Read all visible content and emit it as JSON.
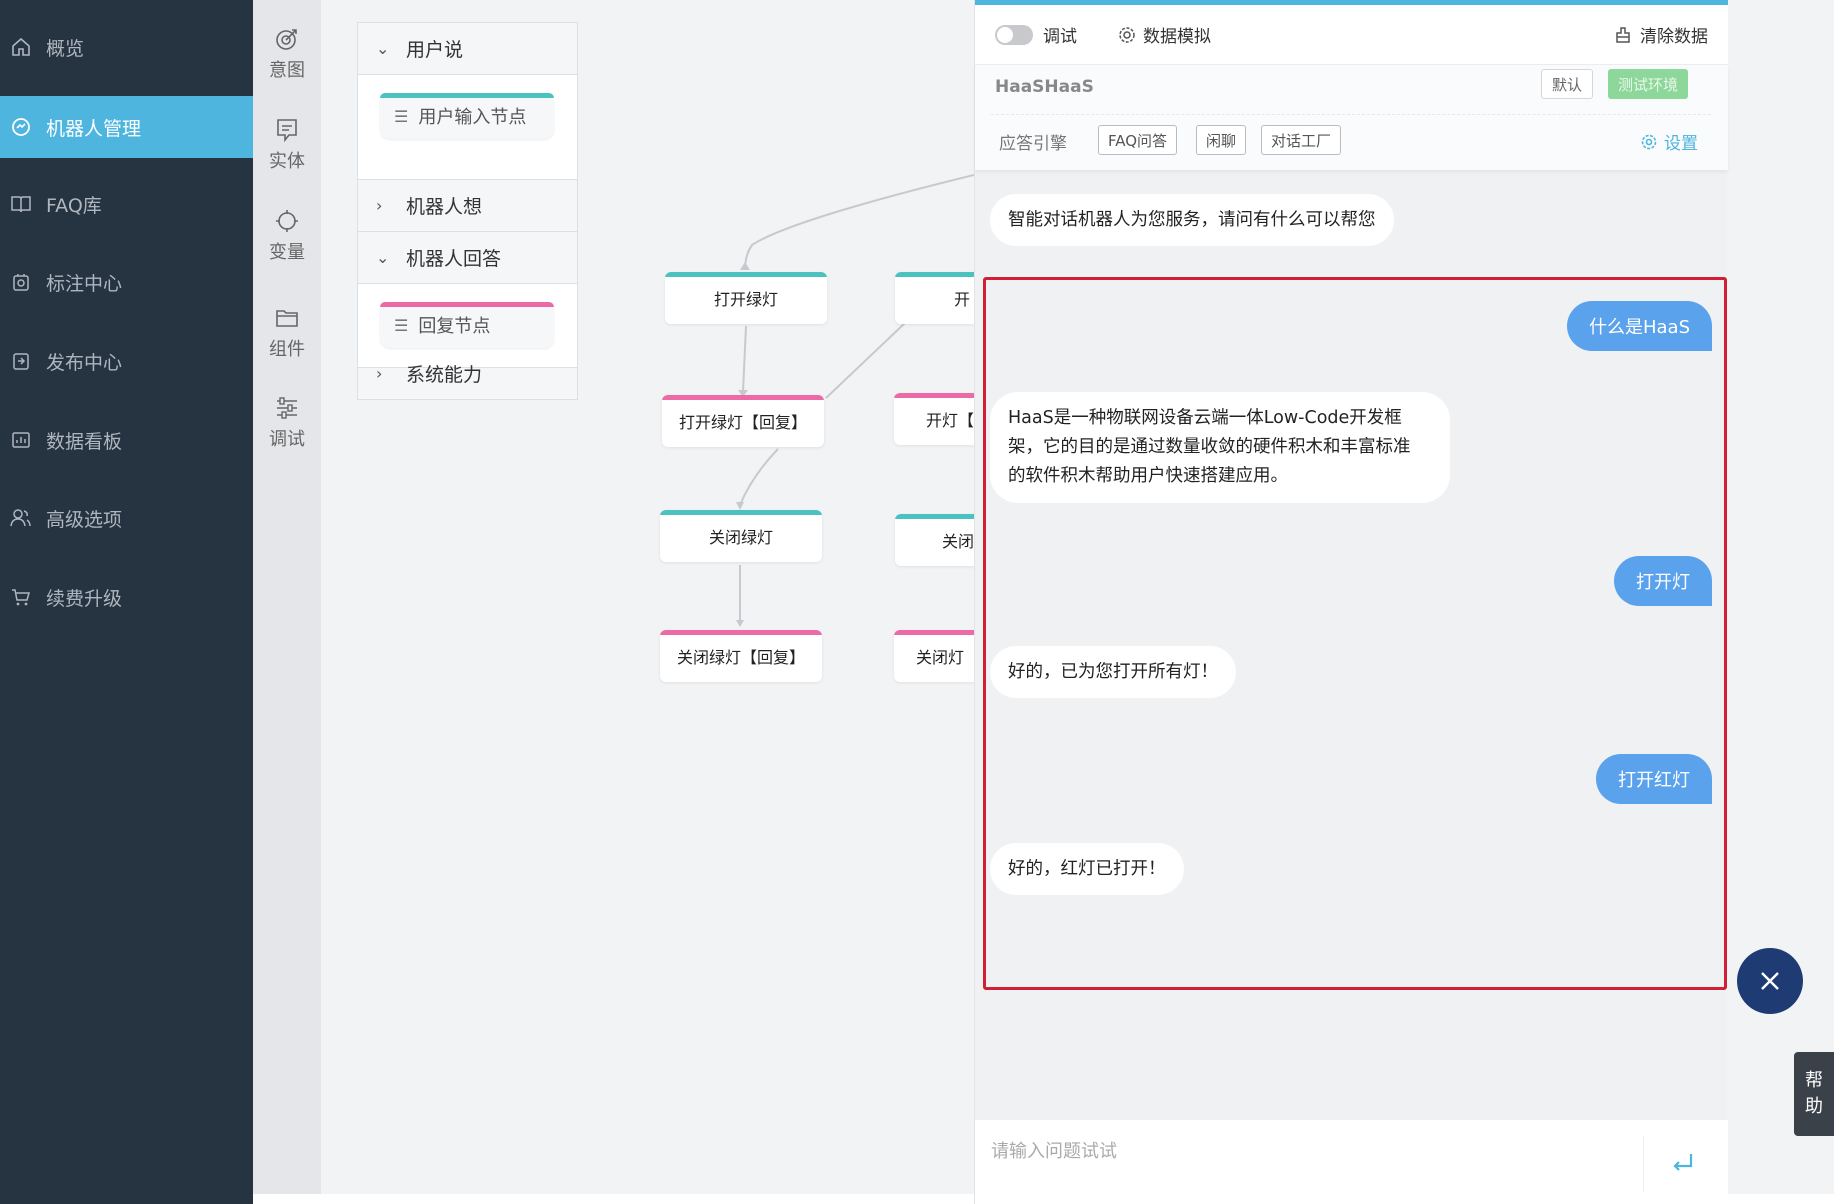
{
  "sidebar": {
    "items": [
      {
        "label": "概览",
        "icon": "home-icon",
        "active": false
      },
      {
        "label": "机器人管理",
        "icon": "robot-icon",
        "active": true
      },
      {
        "label": "FAQ库",
        "icon": "book-icon",
        "active": false
      },
      {
        "label": "标注中心",
        "icon": "tag-icon",
        "active": false
      },
      {
        "label": "发布中心",
        "icon": "publish-icon",
        "active": false
      },
      {
        "label": "数据看板",
        "icon": "dashboard-icon",
        "active": false
      },
      {
        "label": "高级选项",
        "icon": "users-icon",
        "active": false
      },
      {
        "label": "续费升级",
        "icon": "cart-icon",
        "active": false
      }
    ]
  },
  "tools": [
    {
      "label": "意图",
      "icon": "intent-icon"
    },
    {
      "label": "实体",
      "icon": "entity-icon"
    },
    {
      "label": "变量",
      "icon": "variable-icon"
    },
    {
      "label": "组件",
      "icon": "folder-icon"
    },
    {
      "label": "调试",
      "icon": "sliders-icon"
    }
  ],
  "palette": {
    "user_says": "用户说",
    "user_input_node": "用户输入节点",
    "robot_thinks": "机器人想",
    "robot_answers": "机器人回答",
    "reply_node": "回复节点",
    "system_ability": "系统能力"
  },
  "flow": {
    "nodes": [
      "打开绿灯",
      "打开绿灯【回复】",
      "关闭绿灯",
      "关闭绿灯【回复】",
      "开",
      "开灯【",
      "关闭",
      "关闭灯"
    ]
  },
  "chat": {
    "debug_label": "调试",
    "simulate_label": "数据模拟",
    "clear_label": "清除数据",
    "bot_name": "HaaSHaaS",
    "tag_default": "默认",
    "tag_env": "测试环境",
    "engine_label": "应答引擎",
    "engines": [
      "FAQ问答",
      "闲聊",
      "对话工厂"
    ],
    "settings_label": "设置",
    "greeting": "智能对话机器人为您服务，请问有什么可以帮您",
    "messages": [
      {
        "role": "user",
        "text": "什么是HaaS"
      },
      {
        "role": "bot",
        "lines": [
          "HaaS是一种物联网设备云端一体Low-Code开发框",
          "架，它的目的是通过数量收敛的硬件积木和丰富标准",
          "的软件积木帮助用户快速搭建应用。"
        ]
      },
      {
        "role": "user",
        "text": "打开灯"
      },
      {
        "role": "bot",
        "text": "好的，已为您打开所有灯！"
      },
      {
        "role": "user",
        "text": "打开红灯"
      },
      {
        "role": "bot",
        "text": "好的，红灯已打开！"
      }
    ],
    "input_placeholder": "请输入问题试试"
  },
  "help_chars": [
    "帮",
    "助"
  ],
  "colors": {
    "sidebar_bg": "#263340",
    "accent": "#4db5de",
    "user_bubble": "#5ba2ec",
    "highlight": "#d21f35",
    "node_teal": "#4bc2c0",
    "node_pink": "#ec6aa5",
    "fab": "#1f3b73"
  }
}
